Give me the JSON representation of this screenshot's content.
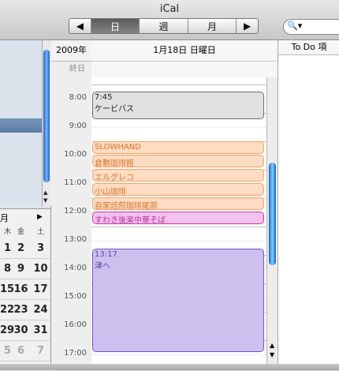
{
  "window": {
    "title": "iCal"
  },
  "view_switcher": {
    "prev": "◀",
    "day": "日",
    "week": "週",
    "month": "月",
    "next": "▶"
  },
  "search": {
    "placeholder": ""
  },
  "header": {
    "year": "2009年",
    "date": "1月18日 日曜日",
    "all_day": "終日"
  },
  "todo": {
    "header": "To Do 項"
  },
  "times": [
    "8:00",
    "9:00",
    "10:00",
    "11:00",
    "12:00",
    "13:00",
    "14:00",
    "15:00",
    "16:00",
    "17:00"
  ],
  "mini_calendar": {
    "month_label": "月",
    "nav_next": "▶",
    "weekday_headers": [
      "木",
      "金",
      "土"
    ],
    "rows": [
      [
        "1",
        "2",
        "3"
      ],
      [
        "8",
        "9",
        "10"
      ],
      [
        "15",
        "16",
        "17"
      ],
      [
        "22",
        "23",
        "24"
      ],
      [
        "29",
        "30",
        "31"
      ],
      [
        "5",
        "6",
        "7"
      ]
    ]
  },
  "events": [
    {
      "time": "7:45",
      "title": "ケービバス",
      "color": "gray"
    },
    {
      "time": "",
      "title": "SLOWHAND",
      "color": "orange"
    },
    {
      "time": "",
      "title": "倉敷珈琲館",
      "color": "orange"
    },
    {
      "time": "",
      "title": "エルグレコ",
      "color": "orange"
    },
    {
      "time": "",
      "title": "小山珈琲",
      "color": "orange"
    },
    {
      "time": "",
      "title": "自家焙煎珈琲尾原",
      "color": "orange"
    },
    {
      "time": "",
      "title": "すわき後楽中華そば",
      "color": "pink"
    },
    {
      "time": "13:17",
      "title": "津へ",
      "color": "purple"
    }
  ]
}
